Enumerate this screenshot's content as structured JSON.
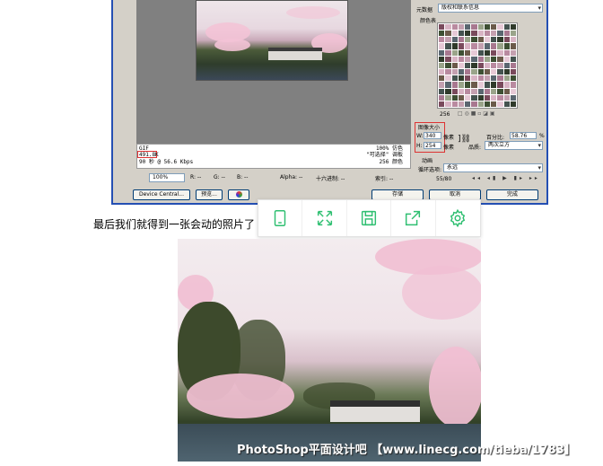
{
  "dialog": {
    "info": {
      "format": "GIF",
      "file_size": "491.8K",
      "download_time": "90 秒 @ 56.6 Kbps",
      "dither": "100% 仿色",
      "palette_mode": "\"可选择\" 调板",
      "colors": "256 颜色"
    },
    "status": {
      "zoom": "100%",
      "r": "R: --",
      "g": "G: --",
      "b": "B: --",
      "alpha": "Alpha: --",
      "hex": "十六进制: --",
      "index": "索引: --"
    },
    "buttons": {
      "device_central": "Device Central...",
      "preview": "预览...",
      "save": "存储",
      "cancel": "取消",
      "done": "完成"
    },
    "settings": {
      "metadata_label": "元数据",
      "metadata_value": "版权和联系信息",
      "color_table_label": "颜色表",
      "color_count": "256",
      "image_size_label": "图像大小",
      "width_label": "W:",
      "width_value": "340",
      "height_label": "H:",
      "height_value": "254",
      "pixels_label": "像素",
      "percent_label": "百分比:",
      "percent_value": "58.76",
      "percent_unit": "%",
      "quality_label": "品质:",
      "quality_value": "两次立方",
      "animation_label": "动画",
      "loop_label": "循环选项:",
      "loop_value": "永远",
      "frame_counter": "55/80"
    }
  },
  "caption": "最后我们就得到一张会动的照片了",
  "toolbar": {
    "accent_color": "#2fbf71",
    "icons": [
      "tablet-icon",
      "expand-icon",
      "save-icon",
      "share-icon",
      "gear-icon"
    ]
  },
  "watermark": "PhotoShop平面设计吧 【www.linecg.com/tieba/1783】"
}
